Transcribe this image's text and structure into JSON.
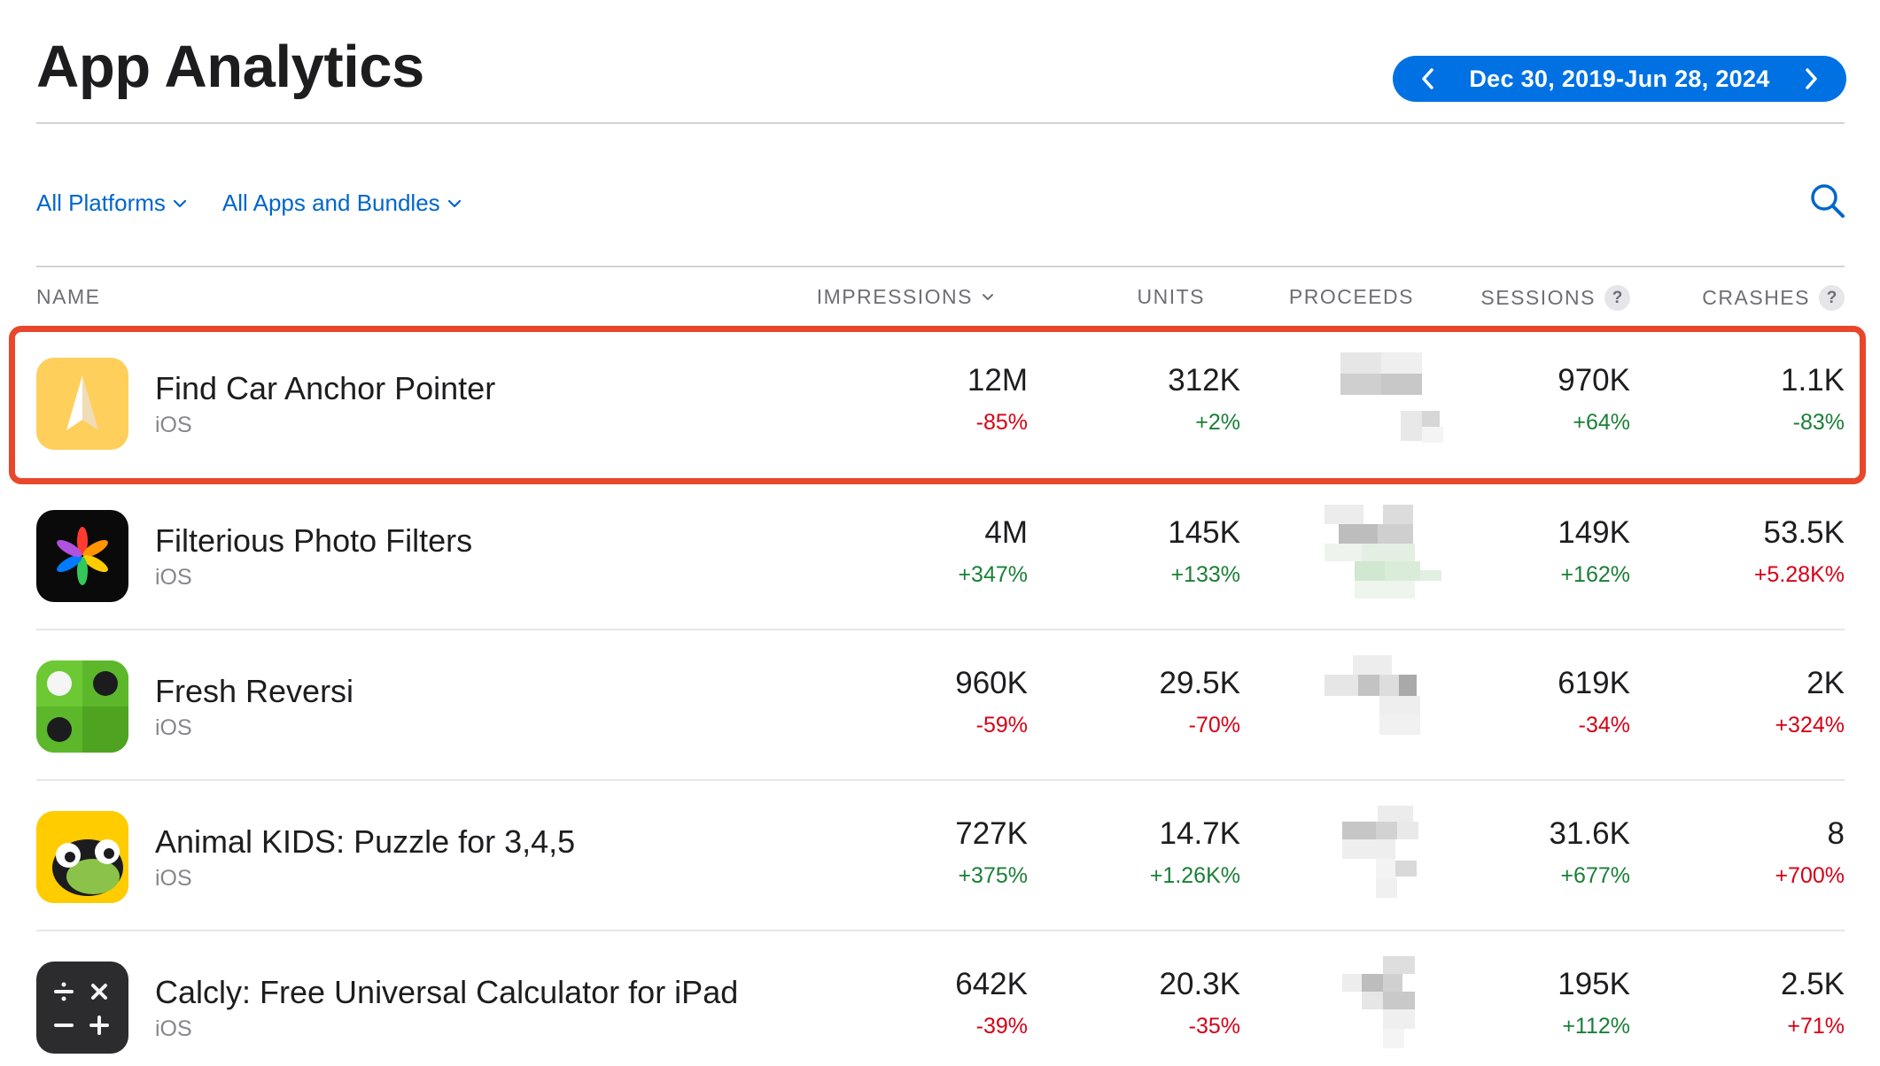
{
  "header": {
    "title": "App Analytics"
  },
  "date_range": {
    "label": "Dec 30, 2019-Jun 28, 2024",
    "prev_icon": "chevron-left-icon",
    "next_icon": "chevron-right-icon"
  },
  "filters": {
    "platforms": "All Platforms",
    "apps": "All Apps and Bundles"
  },
  "columns": {
    "name": "NAME",
    "impressions": "IMPRESSIONS",
    "units": "UNITS",
    "proceeds": "PROCEEDS",
    "sessions": "SESSIONS",
    "crashes": "CRASHES",
    "help": "?"
  },
  "apps": [
    {
      "name": "Find Car Anchor Pointer",
      "platform": "iOS",
      "impressions": "12M",
      "impressions_delta": "-85%",
      "units": "312K",
      "units_delta": "+2%",
      "sessions": "970K",
      "sessions_delta": "+64%",
      "crashes": "1.1K",
      "crashes_delta": "-83%"
    },
    {
      "name": "Filterious Photo Filters",
      "platform": "iOS",
      "impressions": "4M",
      "impressions_delta": "+347%",
      "units": "145K",
      "units_delta": "+133%",
      "sessions": "149K",
      "sessions_delta": "+162%",
      "crashes": "53.5K",
      "crashes_delta": "+5.28K%"
    },
    {
      "name": "Fresh Reversi",
      "platform": "iOS",
      "impressions": "960K",
      "impressions_delta": "-59%",
      "units": "29.5K",
      "units_delta": "-70%",
      "sessions": "619K",
      "sessions_delta": "-34%",
      "crashes": "2K",
      "crashes_delta": "+324%"
    },
    {
      "name": "Animal KIDS: Puzzle for 3,4,5",
      "platform": "iOS",
      "impressions": "727K",
      "impressions_delta": "+375%",
      "units": "14.7K",
      "units_delta": "+1.26K%",
      "sessions": "31.6K",
      "sessions_delta": "+677%",
      "crashes": "8",
      "crashes_delta": "+700%"
    },
    {
      "name": "Calcly: Free Universal Calculator for iPad",
      "platform": "iOS",
      "impressions": "642K",
      "impressions_delta": "-39%",
      "units": "20.3K",
      "units_delta": "-35%",
      "sessions": "195K",
      "sessions_delta": "+112%",
      "crashes": "2.5K",
      "crashes_delta": "+71%"
    }
  ],
  "colors": {
    "accent": "#0071e3",
    "link": "#0066cc",
    "positive": "#1a7f37",
    "negative": "#d70015",
    "highlight": "#e8472b"
  }
}
